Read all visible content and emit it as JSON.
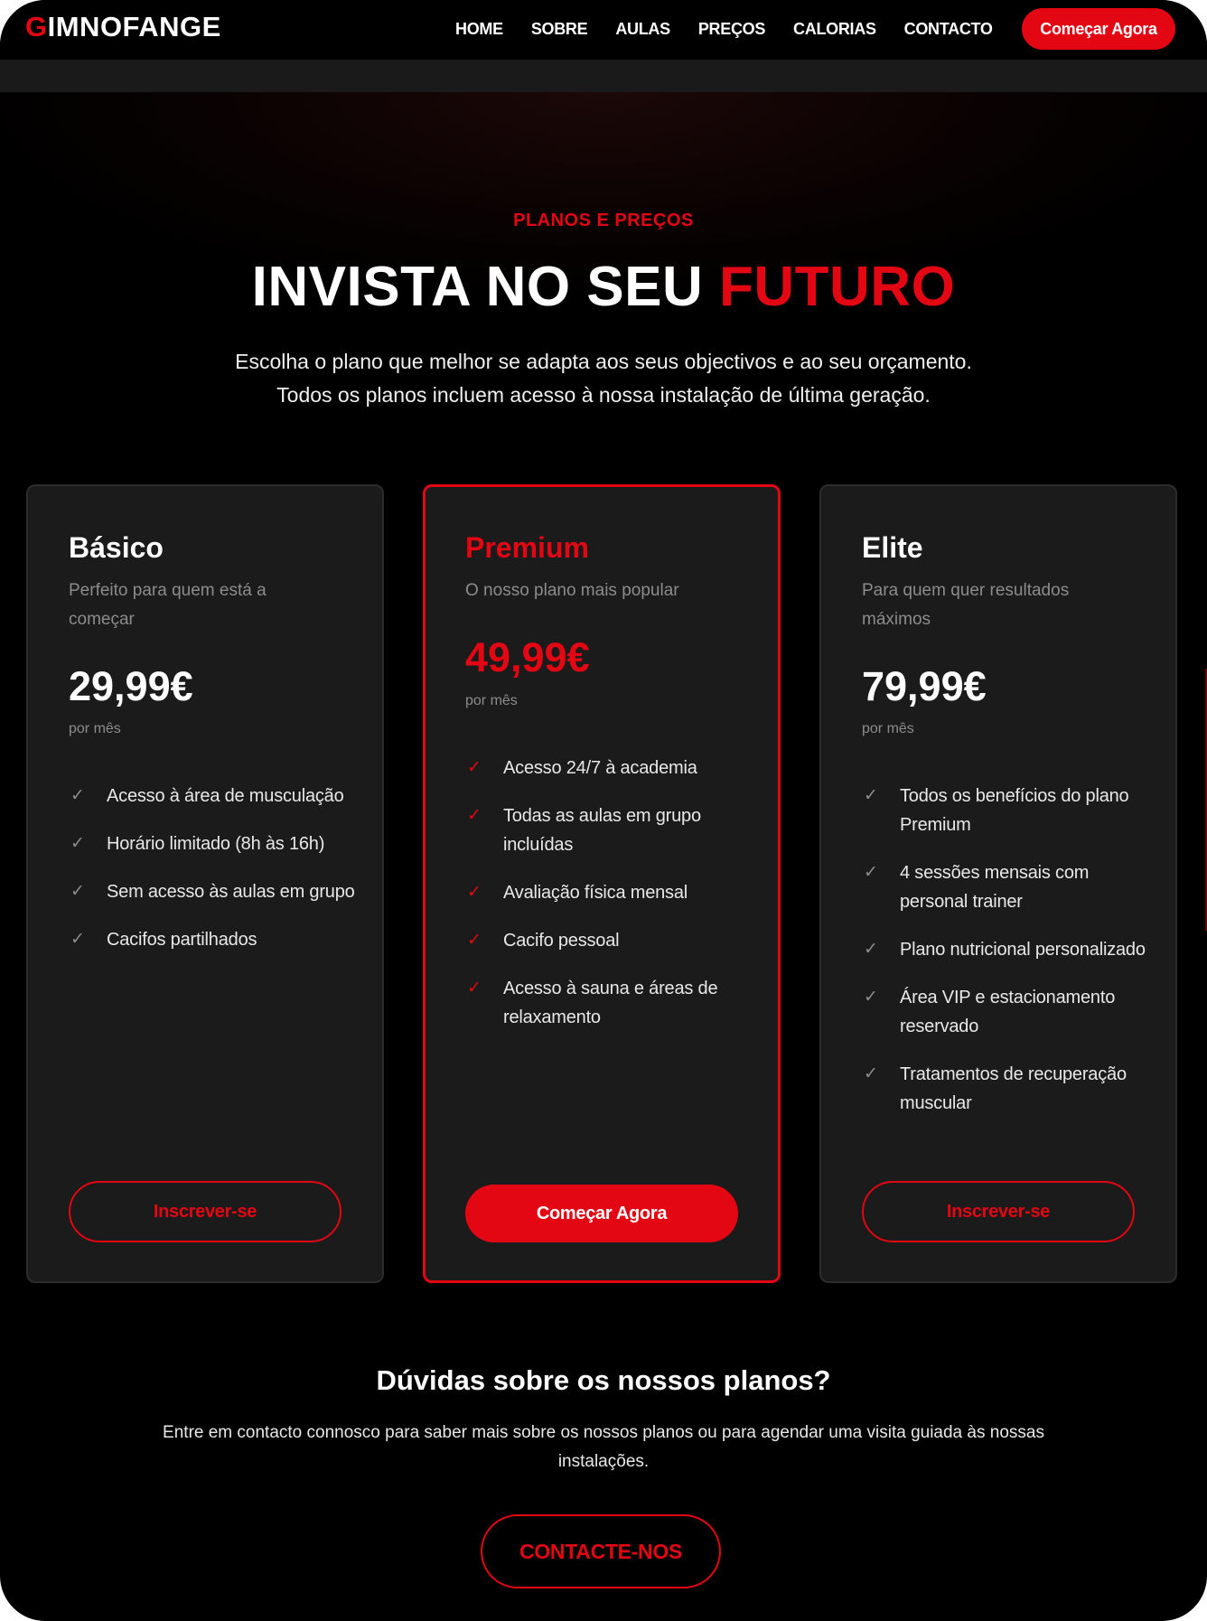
{
  "nav": {
    "logo_first": "G",
    "logo_rest": "IMNOFANGE",
    "links": [
      "HOME",
      "SOBRE",
      "AULAS",
      "PREÇOS",
      "CALORIAS",
      "CONTACTO"
    ],
    "cta": "Começar Agora"
  },
  "hero": {
    "eyebrow": "PLANOS E PREÇOS",
    "title_main": "INVISTA NO SEU ",
    "title_accent": "FUTURO",
    "intro_line1": "Escolha o plano que melhor se adapta aos seus objectivos e ao seu orçamento.",
    "intro_line2": "Todos os planos incluem acesso à nossa instalação de última geração."
  },
  "plans": [
    {
      "name": "Básico",
      "desc": "Perfeito para quem está a começar",
      "price": "29,99€",
      "per": "por mês",
      "features": [
        "Acesso à área de musculação",
        "Horário limitado (8h às 16h)",
        "Sem acesso às aulas em grupo",
        "Cacifos partilhados"
      ],
      "button": "Inscrever-se"
    },
    {
      "name": "Premium",
      "desc": "O nosso plano mais popular",
      "price": "49,99€",
      "per": "por mês",
      "features": [
        "Acesso 24/7 à academia",
        "Todas as aulas em grupo incluídas",
        "Avaliação física mensal",
        "Cacifo pessoal",
        "Acesso à sauna e áreas de relaxamento"
      ],
      "button": "Começar Agora"
    },
    {
      "name": "Elite",
      "desc": "Para quem quer resultados máximos",
      "price": "79,99€",
      "per": "por mês",
      "features": [
        "Todos os benefícios do plano Premium",
        "4 sessões mensais com personal trainer",
        "Plano nutricional personalizado",
        "Área VIP e estacionamento reservado",
        "Tratamentos de recuperação muscular"
      ],
      "button": "Inscrever-se"
    }
  ],
  "faq": {
    "title": "Dúvidas sobre os nossos planos?",
    "text": "Entre em contacto connosco para saber mais sobre os nossos planos ou para agendar uma visita guiada às nossas instalações.",
    "button": "CONTACTE-NOS"
  },
  "colors": {
    "accent": "#e30613",
    "card_bg": "#1b1b1b",
    "page_bg": "#000000"
  },
  "icons": {
    "feature_check": "check-icon"
  }
}
